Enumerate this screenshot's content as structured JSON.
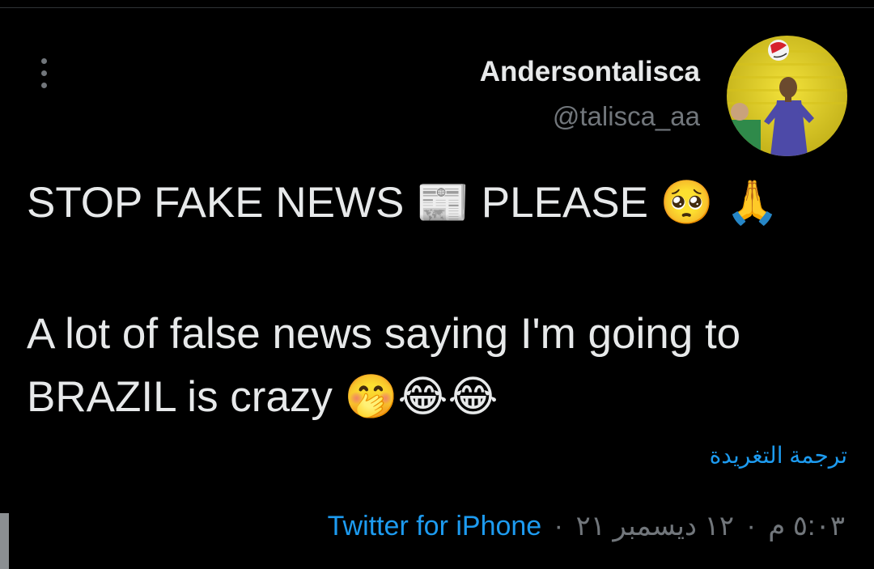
{
  "author": {
    "display_name": "Andersontalisca",
    "handle": "@talisca_aa"
  },
  "tweet": {
    "line1": "STOP FAKE NEWS 📰 PLEASE 🥺 🙏",
    "line2": "A lot of false news saying I'm going to",
    "line3": "BRAZIL is crazy 🤭😂😂"
  },
  "translate_label": "ترجمة التغريدة",
  "meta": {
    "time": "٥:٠٣ م",
    "separator": "·",
    "date": "١٢ ديسمبر ٢١",
    "source": "Twitter for iPhone"
  },
  "colors": {
    "background": "#000000",
    "text": "#e7e9ea",
    "secondary": "#71767b",
    "link": "#1d9bf0"
  },
  "icons": {
    "more": "more-vertical-icon"
  }
}
